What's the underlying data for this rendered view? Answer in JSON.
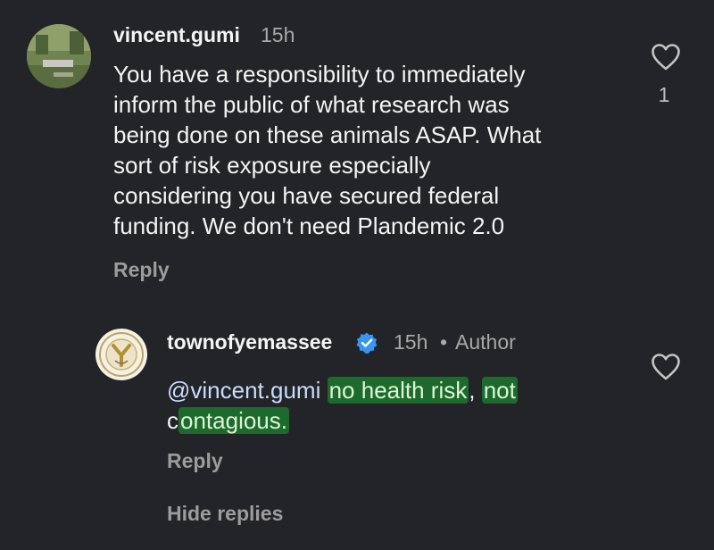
{
  "comment": {
    "username": "vincent.gumi",
    "time": "15h",
    "text": "You have a responsibility to immediately\ninform the public of what research was\nbeing done on these animals ASAP. What\nsort of risk exposure especially\nconsidering you have secured federal\nfunding. We don't need Plandemic 2.0",
    "reply_label": "Reply",
    "likes": "1",
    "icons": {
      "avatar": "user-avatar-photo",
      "like": "heart-outline-icon"
    }
  },
  "reply": {
    "username": "townofyemassee",
    "time": "15h",
    "separator": "•",
    "author_label": "Author",
    "mention": "@vincent.gumi",
    "text_parts": {
      "space1": " ",
      "hl1": "no health risk",
      "comma": ", ",
      "hl2a": "not",
      "c": "c",
      "hl2b": "ontagious."
    },
    "reply_label": "Reply",
    "icons": {
      "avatar": "town-seal-logo",
      "verified": "verified-badge-icon",
      "like": "heart-outline-icon"
    }
  },
  "hide_replies_label": "Hide replies",
  "colors": {
    "background": "#232427",
    "highlight": "#1c6b2c",
    "verified": "#3797f0",
    "mention": "#c9dcff"
  }
}
